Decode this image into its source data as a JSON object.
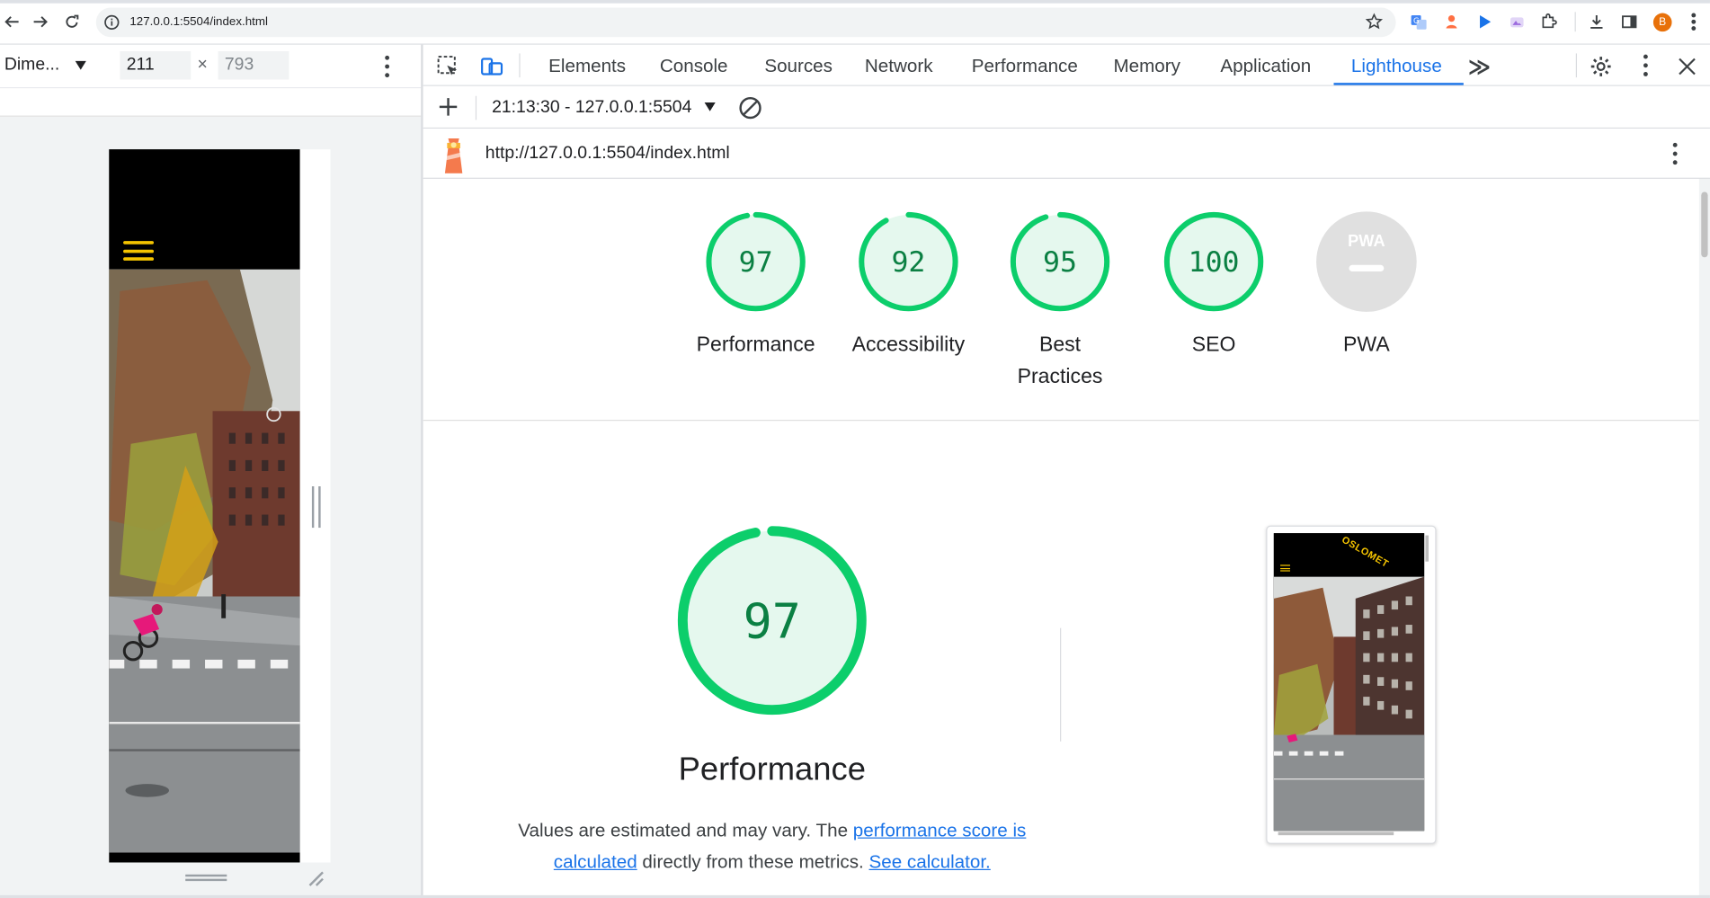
{
  "browser": {
    "url": "127.0.0.1:5504/index.html",
    "avatar_letter": "B"
  },
  "device_toolbar": {
    "device": "Dime...",
    "width": "211",
    "height": "793"
  },
  "devtools": {
    "tabs": [
      {
        "label": "Elements"
      },
      {
        "label": "Console"
      },
      {
        "label": "Sources"
      },
      {
        "label": "Network"
      },
      {
        "label": "Performance"
      },
      {
        "label": "Memory"
      },
      {
        "label": "Application"
      },
      {
        "label": "Lighthouse"
      }
    ],
    "active_tab": "Lighthouse",
    "more_tabs": "≫"
  },
  "lighthouse": {
    "report_select": "21:13:30 - 127.0.0.1:5504",
    "report_url": "http://127.0.0.1:5504/index.html",
    "scores": [
      {
        "score": "97",
        "label": "Performance",
        "fraction": 0.97
      },
      {
        "score": "92",
        "label": "Accessibility",
        "fraction": 0.92
      },
      {
        "score": "95",
        "label": "Best Practices",
        "fraction": 0.95
      },
      {
        "score": "100",
        "label": "SEO",
        "fraction": 1.0
      }
    ],
    "pwa": {
      "badge": "PWA",
      "label": "PWA"
    },
    "performance": {
      "score": "97",
      "fraction": 0.97,
      "title": "Performance",
      "desc_prefix": "Values are estimated and may vary. The ",
      "link_score": "performance score is calculated",
      "desc_middle": " directly from these metrics. ",
      "link_calc": "See calculator."
    },
    "thumbnail_brand": "OSLOMET"
  },
  "colors": {
    "pass": "#0cce6b",
    "pass_fill": "#e5f8ee",
    "pass_text": "#0b8043",
    "link": "#1a73e8",
    "accent_yellow": "#f5c400"
  }
}
